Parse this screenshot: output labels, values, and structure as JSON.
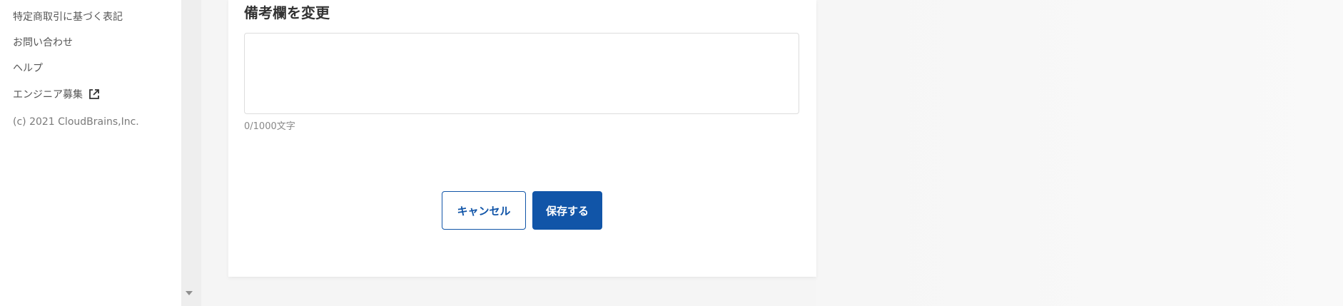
{
  "sidebar": {
    "links": [
      {
        "label": "特定商取引に基づく表記"
      },
      {
        "label": "お問い合わせ"
      },
      {
        "label": "ヘルプ"
      },
      {
        "label": "エンジニア募集",
        "icon": "external-link-icon"
      }
    ],
    "copyright": "(c) 2021 CloudBrains,Inc."
  },
  "form": {
    "title": "備考欄を変更",
    "remarks_value": "",
    "remarks_placeholder": "",
    "char_count": "0/1000文字",
    "cancel_label": "キャンセル",
    "save_label": "保存する"
  },
  "colors": {
    "accent": "#1155a8",
    "background": "#f5f5f5",
    "sidebar": "#ffffff",
    "text": "#333333"
  }
}
